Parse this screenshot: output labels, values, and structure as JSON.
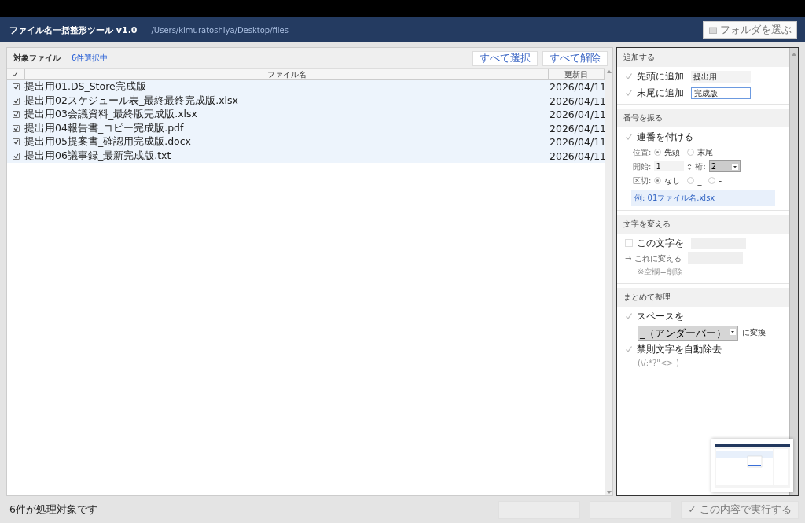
{
  "header": {
    "title": "ファイル名一括整形ツール v1.0",
    "path": "/Users/kimuratoshiya/Desktop/files",
    "folder_button": "フォルダを選ぶ"
  },
  "files": {
    "title": "対象ファイル",
    "selected_count": "6件選択中",
    "select_all": "すべて選択",
    "deselect_all": "すべて解除",
    "columns": [
      "✓",
      "ファイル名",
      "更新日"
    ],
    "rows": [
      {
        "name": "提出用01.DS_Store完成版",
        "date": "2026/04/11",
        "checked": true
      },
      {
        "name": "提出用02スケジュール表_最終最終完成版.xlsx",
        "date": "2026/04/11",
        "checked": true
      },
      {
        "name": "提出用03会議資料_最終版完成版.xlsx",
        "date": "2026/04/11",
        "checked": true
      },
      {
        "name": "提出用04報告書_コピー完成版.pdf",
        "date": "2026/04/11",
        "checked": true
      },
      {
        "name": "提出用05提案書_確認用完成版.docx",
        "date": "2026/04/11",
        "checked": true
      },
      {
        "name": "提出用06議事録_最新完成版.txt",
        "date": "2026/04/11",
        "checked": true
      }
    ]
  },
  "settings": {
    "add": {
      "title": "追加する",
      "items": [
        {
          "label": "先頭に追加",
          "checked": true,
          "value": "提出用",
          "focused": false
        },
        {
          "label": "末尾に追加",
          "checked": true,
          "value": "完成版",
          "focused": true
        }
      ]
    },
    "number": {
      "title": "番号を振る",
      "label": "連番を付ける",
      "checked": true,
      "position_label": "位置:",
      "positions": [
        {
          "label": "先頭",
          "selected": true
        },
        {
          "label": "末尾",
          "selected": false
        }
      ],
      "start_label": "開始:",
      "start": "1",
      "digits_label": "桁:",
      "digits": "2",
      "separator_label": "区切:",
      "separators": [
        {
          "label": "なし",
          "selected": true
        },
        {
          "label": "_",
          "selected": false
        },
        {
          "label": "-",
          "selected": false
        }
      ],
      "example": "例: 01ファイル名.xlsx"
    },
    "replace": {
      "title": "文字を変える",
      "label": "この文字を",
      "checked": false,
      "to_label": "→ これに変える",
      "hint": "※空欄=削除"
    },
    "cleanup": {
      "title": "まとめて整理",
      "space_label": "スペースを",
      "space_checked": true,
      "space_value": "_（アンダーバー）",
      "space_suffix": "に変換",
      "forbidden_label": "禁則文字を自動除去",
      "forbidden_checked": true,
      "forbidden_hint": "(\\/:*?\"<>|)"
    }
  },
  "status_bar": {
    "text": "6件が処理対象です",
    "run_button": "✓ この内容で実行する"
  }
}
